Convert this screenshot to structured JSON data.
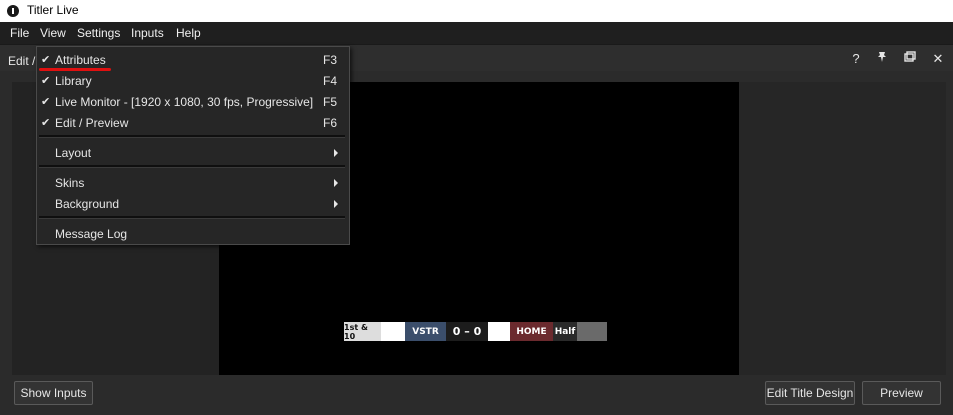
{
  "window": {
    "title": "Titler Live"
  },
  "menubar": {
    "items": [
      {
        "label": "File"
      },
      {
        "label": "View"
      },
      {
        "label": "Settings"
      },
      {
        "label": "Inputs"
      },
      {
        "label": "Help"
      }
    ]
  },
  "panel": {
    "title": "Edit / Preview",
    "controls": [
      "help-icon",
      "pin-icon",
      "restore-icon",
      "close-icon"
    ],
    "control_glyphs": {
      "help": "?",
      "pin": "📌",
      "restore": "❐",
      "close": "✕"
    }
  },
  "view_menu": {
    "items": [
      {
        "label": "Attributes",
        "shortcut": "F3",
        "checked": "✔"
      },
      {
        "label": "Library",
        "shortcut": "F4",
        "checked": "✔"
      },
      {
        "label": "Live Monitor - [1920 x 1080, 30 fps, Progressive]",
        "shortcut": "F5",
        "checked": "✔"
      },
      {
        "label": "Edit / Preview",
        "shortcut": "F6",
        "checked": "✔"
      },
      {
        "label": "Layout"
      },
      {
        "label": "Skins"
      },
      {
        "label": "Background"
      },
      {
        "label": "Message Log"
      }
    ]
  },
  "scorebug": {
    "down": "1st & 10",
    "visitor": "VSTR",
    "score": "0 – 0",
    "home": "HOME",
    "period": "Half",
    "colors": {
      "visitor": "#3b4e6b",
      "home": "#6b2a2e",
      "score": "#1c1c1c"
    }
  },
  "buttons": {
    "show_inputs": "Show Inputs",
    "edit_title_design": "Edit Title Design",
    "preview": "Preview"
  },
  "colors": {
    "annotation": "#e01010",
    "background": "#2b2b2b"
  }
}
